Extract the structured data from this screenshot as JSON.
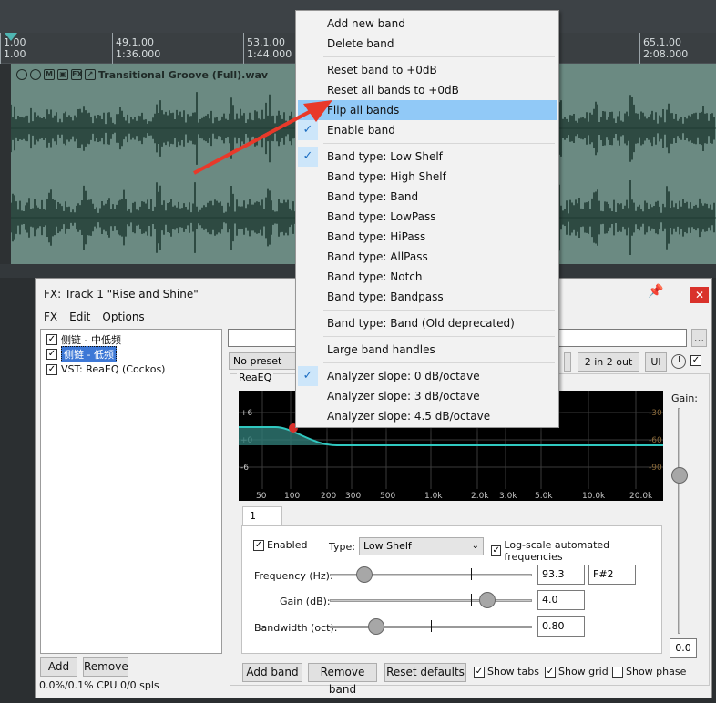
{
  "arrange": {
    "ruler_marks": [
      {
        "bar": "1.00",
        "time": "1.00"
      },
      {
        "bar": "49.1.00",
        "time": "1:36.000"
      },
      {
        "bar": "53.1.00",
        "time": "1:44.000"
      },
      {
        "bar": "65.1.00",
        "time": "2:08.000"
      }
    ],
    "item_name": "Transitional Groove (Full).wav",
    "item_icons": [
      "M",
      "FX"
    ]
  },
  "fx_window": {
    "title": "FX: Track 1 \"Rise and Shine\"",
    "menu": [
      "FX",
      "Edit",
      "Options"
    ],
    "chain": [
      {
        "label": "侧链 - 中低频",
        "checked": true,
        "selected": false
      },
      {
        "label": "侧链 - 低频",
        "checked": true,
        "selected": true
      },
      {
        "label": "VST: ReaEQ (Cockos)",
        "checked": true,
        "selected": false
      }
    ],
    "add_label": "Add",
    "remove_label": "Remove",
    "cpu": "0.0%/0.1% CPU 0/0 spls",
    "preset": "No preset",
    "io_label": "2 in 2 out",
    "ui_label": "UI",
    "dots": "...",
    "plugin_name": "ReaEQ",
    "gain_label": "Gain:",
    "gain_value": "0.0",
    "graph": {
      "db_left": [
        "+6",
        "+0",
        "-6"
      ],
      "db_right": [
        "-30",
        "-60",
        "-90"
      ],
      "freq_labels": [
        "50",
        "100",
        "200",
        "300",
        "500",
        "1.0k",
        "2.0k",
        "3.0k",
        "5.0k",
        "10.0k",
        "20.0k"
      ],
      "curve_color": "#30c8c0"
    },
    "band": {
      "tab": "1",
      "enabled_label": "Enabled",
      "enabled": true,
      "type_label": "Type:",
      "type_value": "Low Shelf",
      "logscale_label": "Log-scale automated frequencies",
      "logscale": true,
      "frequency_label": "Frequency (Hz):",
      "frequency_value": "93.3",
      "note_value": "F#2",
      "gain_label": "Gain (dB):",
      "gain_value": "4.0",
      "bandwidth_label": "Bandwidth (oct):",
      "bandwidth_value": "0.80"
    },
    "bottom": {
      "add_band": "Add band",
      "remove_band": "Remove band",
      "reset_defaults": "Reset defaults",
      "show_tabs": "Show tabs",
      "show_grid": "Show grid",
      "show_phase": "Show phase"
    }
  },
  "context_menu": {
    "items": [
      {
        "label": "Add new band",
        "checked": false
      },
      {
        "label": "Delete band",
        "checked": false
      },
      {
        "label": "Reset band to +0dB",
        "checked": false
      },
      {
        "label": "Reset all bands to +0dB",
        "checked": false
      },
      {
        "label": "Flip all bands",
        "checked": false,
        "highlighted": true
      },
      {
        "label": "Enable band",
        "checked": true
      },
      {
        "label": "Band type: Low Shelf",
        "checked": true
      },
      {
        "label": "Band type: High Shelf",
        "checked": false
      },
      {
        "label": "Band type: Band",
        "checked": false
      },
      {
        "label": "Band type: LowPass",
        "checked": false
      },
      {
        "label": "Band type: HiPass",
        "checked": false
      },
      {
        "label": "Band type: AllPass",
        "checked": false
      },
      {
        "label": "Band type: Notch",
        "checked": false
      },
      {
        "label": "Band type: Bandpass",
        "checked": false
      },
      {
        "label": "Band type: Band (Old deprecated)",
        "checked": false
      },
      {
        "label": "Large band handles",
        "checked": false
      },
      {
        "label": "Analyzer slope: 0 dB/octave",
        "checked": true
      },
      {
        "label": "Analyzer slope: 3 dB/octave",
        "checked": false
      },
      {
        "label": "Analyzer slope: 4.5 dB/octave",
        "checked": false
      }
    ]
  },
  "colors": {
    "highlight": "#91c9f7",
    "track": "#6b8a82",
    "waveform": "#1f3a32",
    "arrow": "#e8392a"
  }
}
